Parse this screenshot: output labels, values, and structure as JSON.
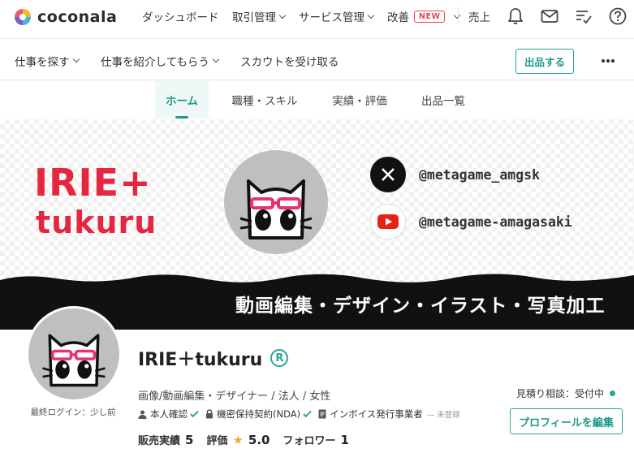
{
  "brand": {
    "logo_text": "coconala"
  },
  "topnav": {
    "dashboard": "ダッシュボード",
    "transactions": "取引管理",
    "services": "サービス管理",
    "improve": "改善",
    "new_badge": "NEW",
    "sales": "売上"
  },
  "icons": {
    "notifications": "bell-icon",
    "messages": "mail-icon",
    "tasks": "checklist-icon",
    "help": "help-icon"
  },
  "subnav": {
    "find_work": "仕事を探す",
    "get_referred": "仕事を紹介してもらう",
    "receive_scout": "スカウトを受け取る",
    "post_button": "出品する"
  },
  "tabs": [
    {
      "label": "ホーム",
      "active": true
    },
    {
      "label": "職種・スキル",
      "active": false
    },
    {
      "label": "実績・評価",
      "active": false
    },
    {
      "label": "出品一覧",
      "active": false
    }
  ],
  "banner": {
    "brand_line1": "IRIE+",
    "brand_line2": "tukuru",
    "social": [
      {
        "icon": "x-logo-icon",
        "handle": "@metagame_amgsk"
      },
      {
        "icon": "youtube-icon",
        "handle": "@metagame-amagasaki"
      }
    ],
    "tagline": "動画編集・デザイン・イラスト・写真加工"
  },
  "profile": {
    "last_login": "最終ログイン：少し前",
    "name": "IRIE＋tukuru",
    "registered_mark": "R",
    "meta": "画像/動画編集・デザイナー / 法人 / 女性",
    "verifications": {
      "identity": "本人確認",
      "nda": "機密保持契約(NDA)",
      "invoice": "インボイス発行事業者",
      "invoice_status": "未登録"
    },
    "stats": {
      "sales_label": "販売実績",
      "sales_value": "5",
      "rating_label": "評価",
      "rating_value": "5.0",
      "followers_label": "フォロワー",
      "followers_value": "1"
    },
    "estimate_status": "見積り相談：受付中",
    "edit_button": "プロフィールを編集"
  },
  "colors": {
    "accent": "#1d9a8b",
    "brand_red": "#e6263f",
    "new_badge": "#e5484d",
    "star": "#f2a93b"
  }
}
